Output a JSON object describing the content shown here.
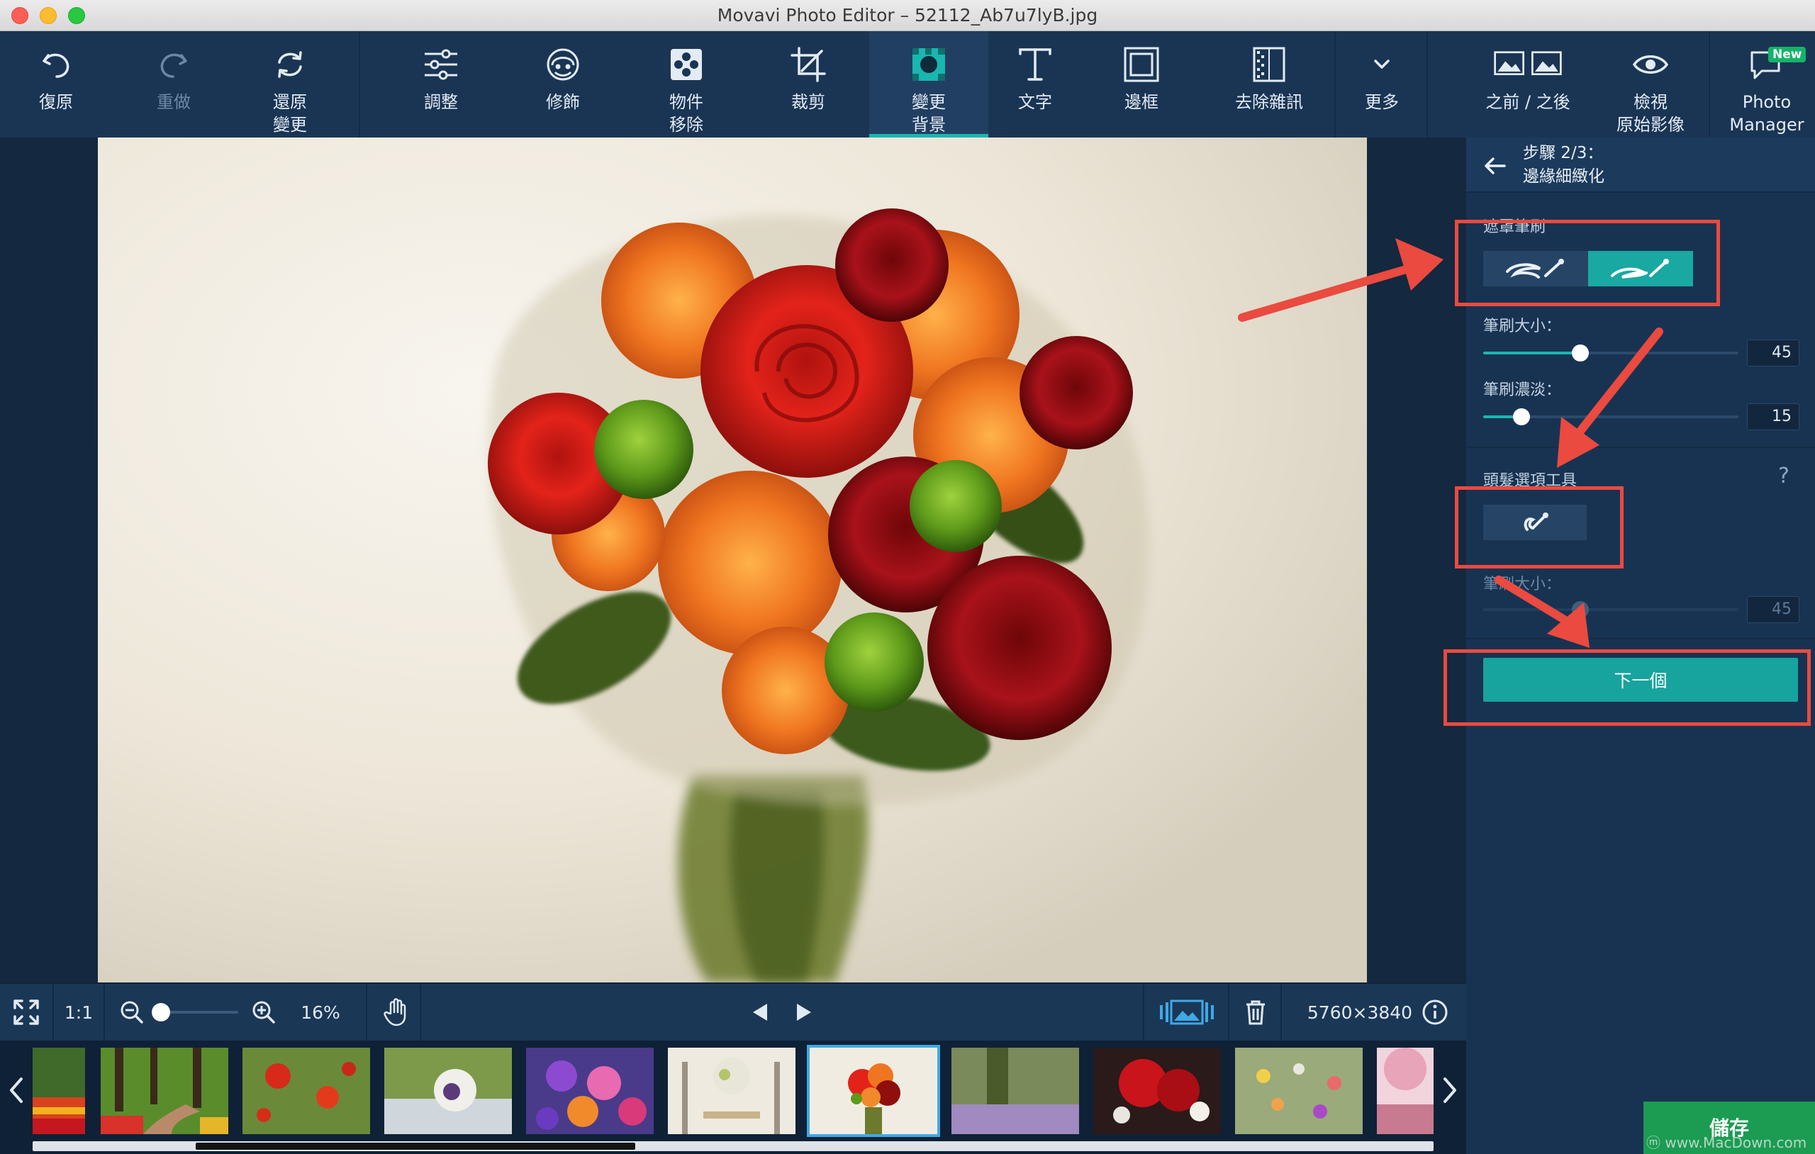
{
  "window": {
    "title": "Movavi Photo Editor – 52112_Ab7u7lyB.jpg"
  },
  "toolbar": {
    "undo": "復原",
    "redo": "重做",
    "revert": "還原\n變更",
    "adjust": "調整",
    "retouch": "修飾",
    "object_removal": "物件\n移除",
    "crop": "裁剪",
    "change_background": "變更\n背景",
    "text": "文字",
    "frames": "邊框",
    "denoise": "去除雜訊",
    "more": "更多",
    "before_after": "之前 / 之後",
    "view_original": "檢視\n原始影像",
    "photo_manager": "Photo\nManager",
    "new_badge": "New"
  },
  "panel": {
    "step": "步驟 2/3：",
    "step_name": "邊緣細緻化",
    "mask_brush_label": "遮罩筆刷",
    "brush_size_label": "筆刷大小：",
    "brush_size_value": "45",
    "brush_size_fraction": 0.38,
    "brush_softness_label": "筆刷濃淡：",
    "brush_softness_value": "15",
    "brush_softness_fraction": 0.15,
    "hair_tool_label": "頭髮選項工具",
    "hair_brush_size_label": "筆刷大小：",
    "hair_brush_size_value": "45",
    "hair_brush_size_fraction": 0.38,
    "help": "?",
    "next_button": "下一個",
    "save_button": "儲存"
  },
  "bottom_bar": {
    "actual_size": "1:1",
    "zoom_value": "16%",
    "zoom_fraction": 0.06,
    "image_size": "5760×3840"
  },
  "watermark": "ⓜ www.MacDown.com",
  "colors": {
    "accent_teal": "#18b7b0",
    "toolbar_bg": "#1a3554",
    "annotation_red": "#ea4a3f",
    "save_green": "#1b9c52"
  },
  "icons": {
    "undo": "undo-icon",
    "redo": "redo-icon",
    "revert": "revert-icon",
    "adjust": "sliders-icon",
    "retouch": "face-icon",
    "object_removal": "eraser-icon",
    "crop": "crop-icon",
    "change_background": "background-icon",
    "text": "text-icon",
    "frames": "frame-icon",
    "denoise": "noise-icon",
    "more": "chevron-down-icon",
    "before_after": "compare-icon",
    "view_original": "eye-icon",
    "photo_manager": "chat-icon"
  }
}
